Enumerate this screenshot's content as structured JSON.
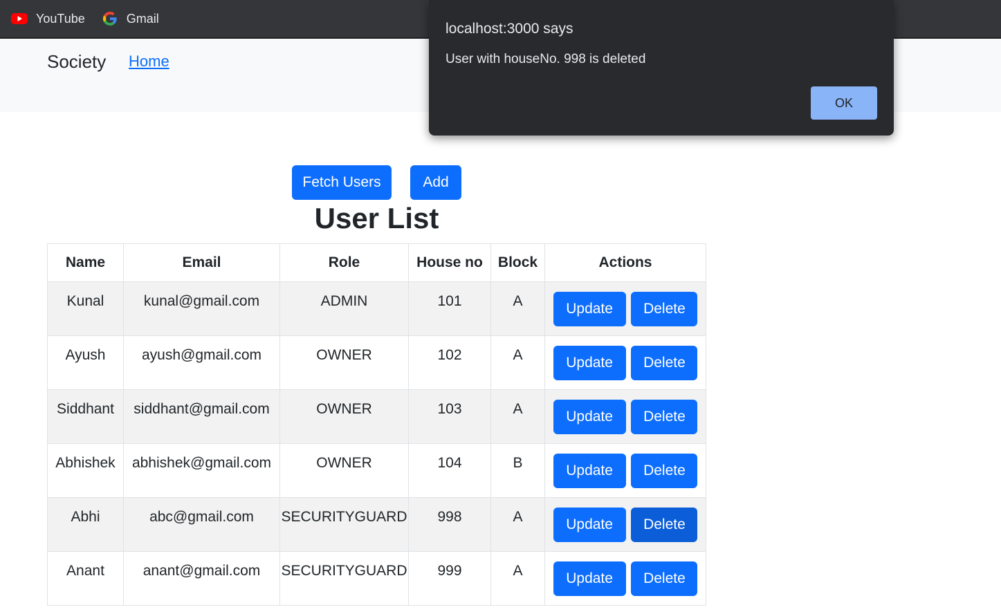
{
  "bookmarks": [
    {
      "label": "YouTube",
      "icon": "youtube-icon"
    },
    {
      "label": "Gmail",
      "icon": "google-icon"
    }
  ],
  "navbar": {
    "brand": "Society",
    "links": [
      "Home"
    ]
  },
  "actions": {
    "fetch_label": "Fetch Users",
    "add_label": "Add"
  },
  "page_title": "User List",
  "table": {
    "headers": [
      "Name",
      "Email",
      "Role",
      "House no",
      "Block",
      "Actions"
    ],
    "update_label": "Update",
    "delete_label": "Delete",
    "rows": [
      {
        "name": "Kunal",
        "email": "kunal@gmail.com",
        "role": "ADMIN",
        "house": "101",
        "block": "A"
      },
      {
        "name": "Ayush",
        "email": "ayush@gmail.com",
        "role": "OWNER",
        "house": "102",
        "block": "A"
      },
      {
        "name": "Siddhant",
        "email": "siddhant@gmail.com",
        "role": "OWNER",
        "house": "103",
        "block": "A"
      },
      {
        "name": "Abhishek",
        "email": "abhishek@gmail.com",
        "role": "OWNER",
        "house": "104",
        "block": "B"
      },
      {
        "name": "Abhi",
        "email": "abc@gmail.com",
        "role": "SECURITYGUARD",
        "house": "998",
        "block": "A"
      },
      {
        "name": "Anant",
        "email": "anant@gmail.com",
        "role": "SECURITYGUARD",
        "house": "999",
        "block": "A"
      }
    ]
  },
  "dialog": {
    "title": "localhost:3000 says",
    "message": "User with houseNo.  998 is deleted",
    "ok_label": "OK"
  },
  "colors": {
    "primary": "#0d6efd",
    "primary_active": "#0b5ed7",
    "dialog_bg": "#292a2d",
    "dialog_ok": "#8ab4f8",
    "bookmarks_bg": "#35363a"
  }
}
